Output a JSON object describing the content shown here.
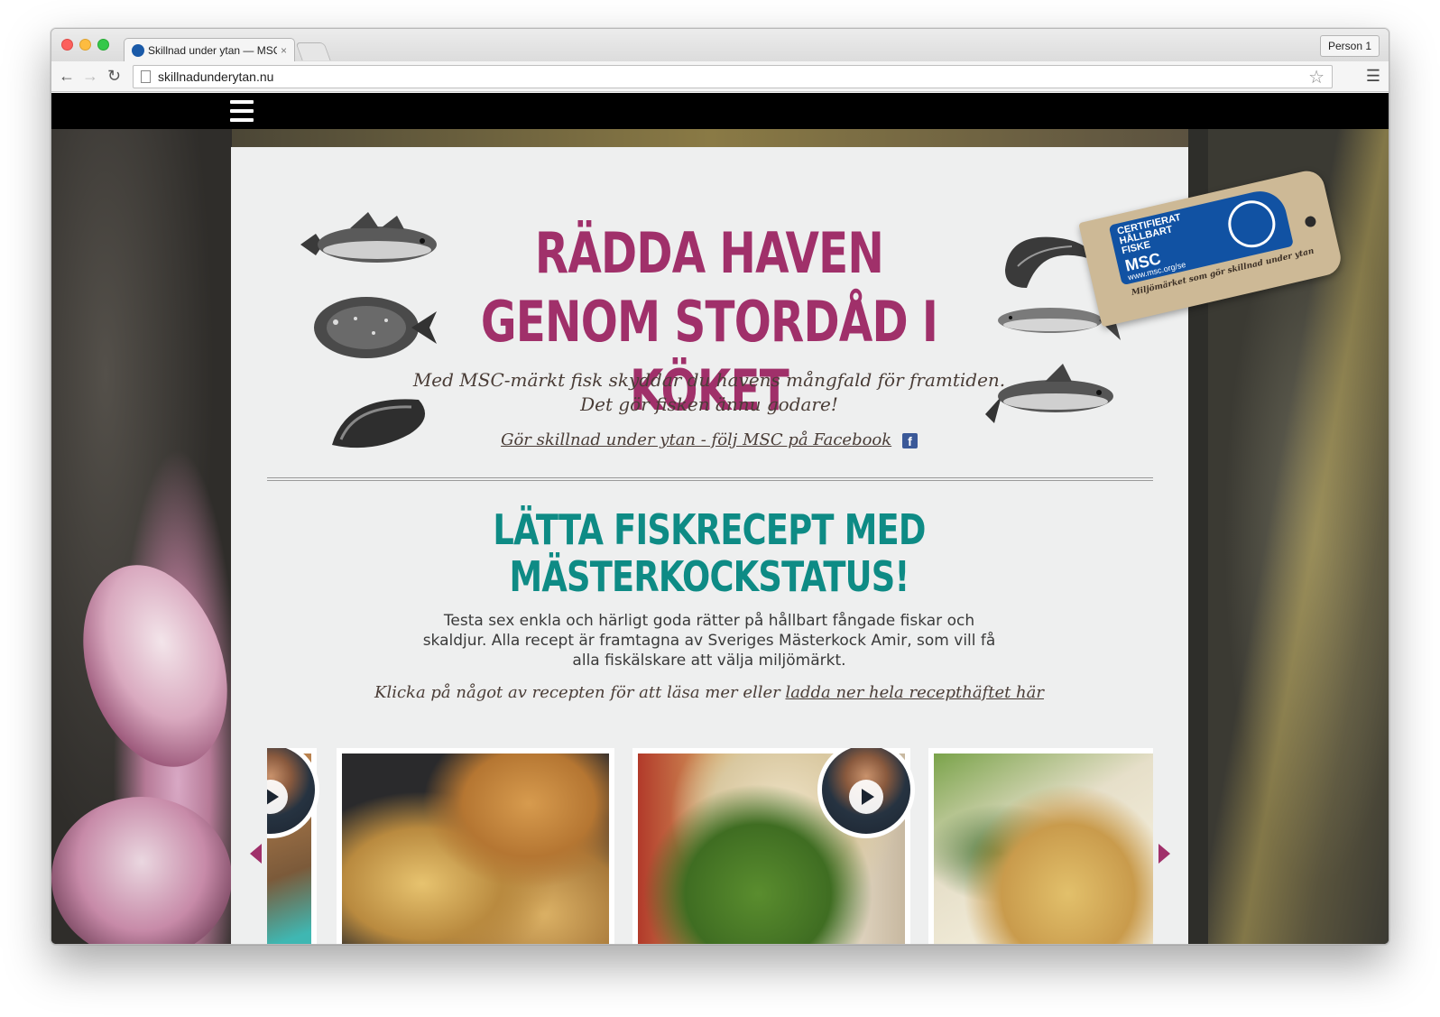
{
  "browser": {
    "tab_title": "Skillnad under ytan — MSC",
    "tab_close": "×",
    "profile": "Person 1",
    "url": "skillnadunderytan.nu"
  },
  "hero": {
    "title": "RÄDDA HAVEN GENOM STORDÅD I KÖKET",
    "subtitle_line1": "Med MSC-märkt fisk skyddar du havens mångfald för framtiden.",
    "subtitle_line2": "Det gör fisken ännu godare!",
    "facebook_link": "Gör skillnad under ytan - följ MSC på Facebook",
    "facebook_icon_letter": "f"
  },
  "msc_tag": {
    "certified": "CERTIFIERAT",
    "sustainable": "HÅLLBART",
    "fishing": "FISKE",
    "logo": "MSC",
    "url": "www.msc.org/se",
    "tagline": "Miljömärket som gör skillnad under ytan"
  },
  "recipes": {
    "title_line1": "LÄTTA FISKRECEPT MED",
    "title_line2": "MÄSTERKOCKSTATUS!",
    "body": "Testa sex enkla och härligt goda rätter på hållbart fångade fiskar och skaldjur. Alla recept är framtagna av Sveriges Mästerkock Amir, som vill få alla fiskälskare att välja miljömärkt.",
    "cta_text": "Klicka på något av recepten för att läsa mer eller ",
    "cta_link": "ladda ner hela recepthäftet här"
  },
  "icons": {
    "menu": "hamburger-icon",
    "prev": "arrow-left-icon",
    "next": "arrow-right-icon",
    "play": "play-icon"
  },
  "colors": {
    "accent_magenta": "#a0306a",
    "accent_teal": "#0e8b85",
    "msc_blue": "#1152a3",
    "facebook_blue": "#3b5998"
  }
}
